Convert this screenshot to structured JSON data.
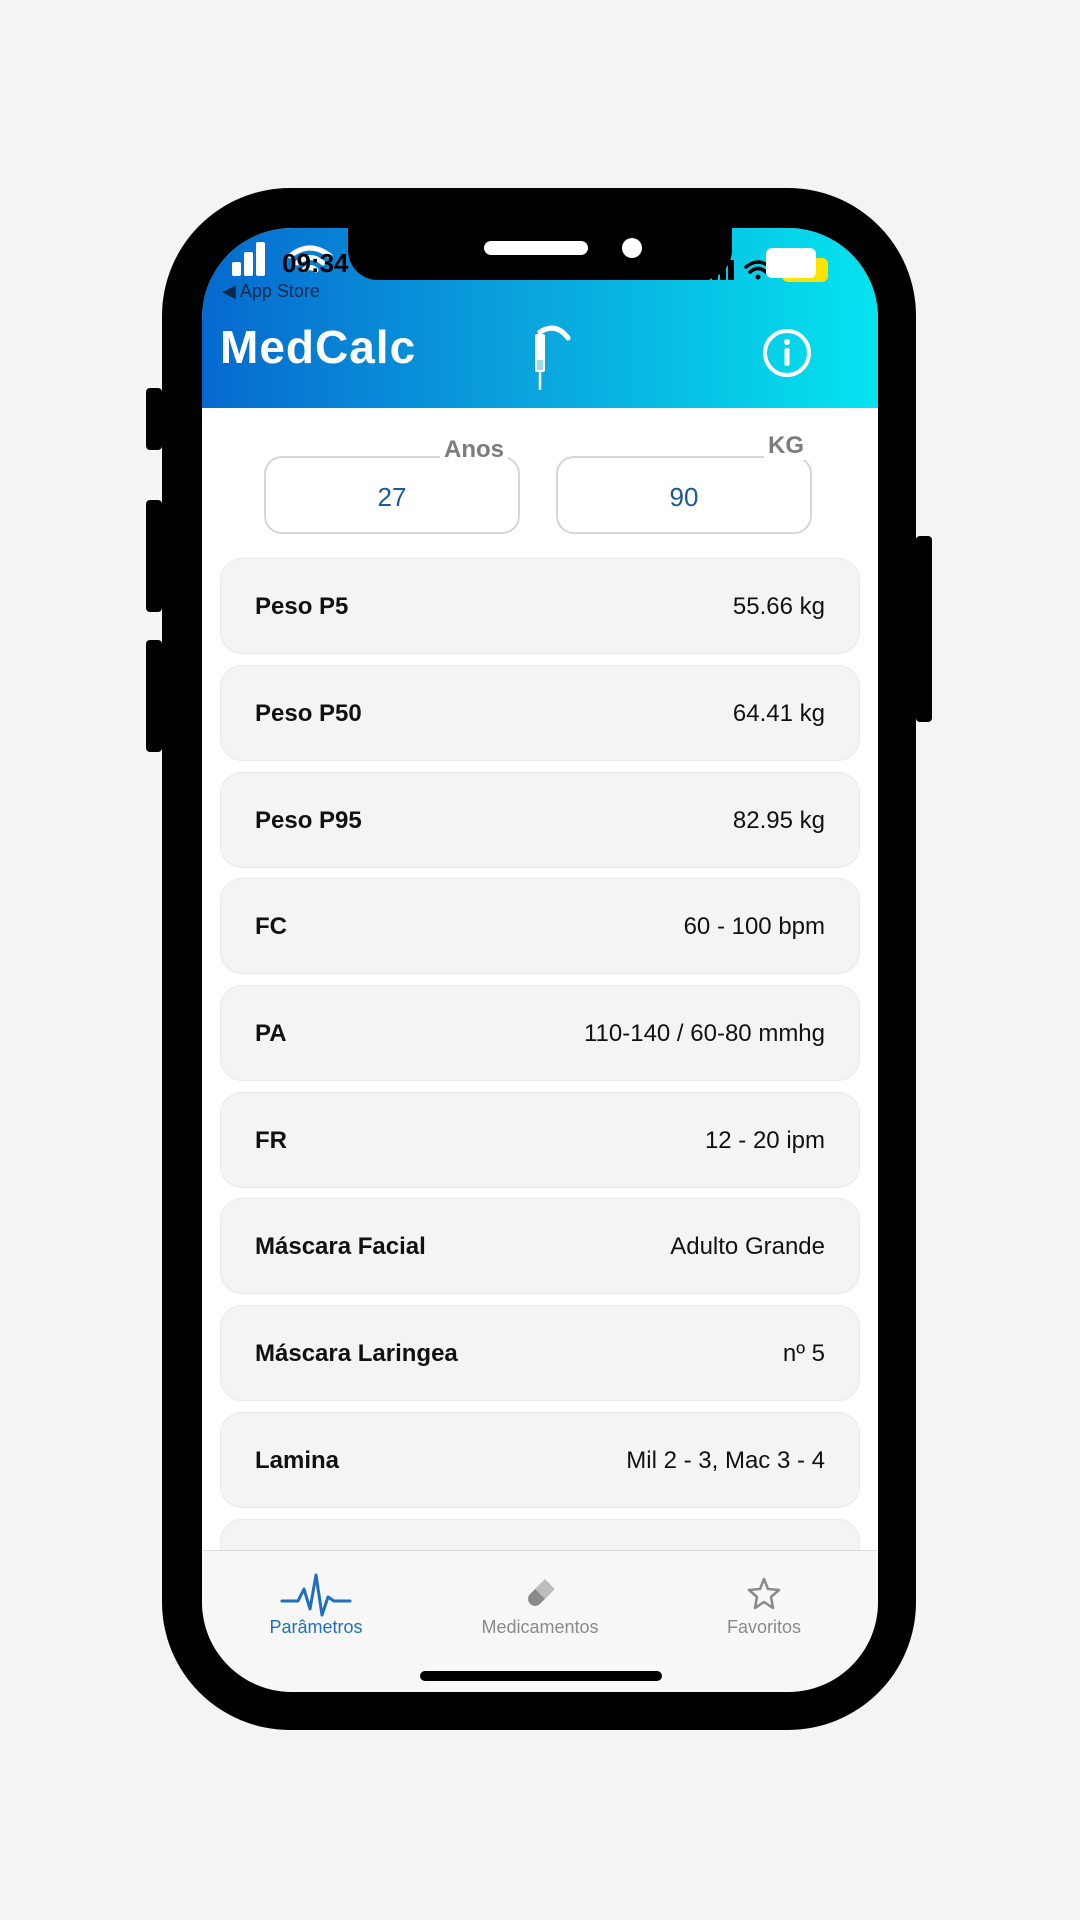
{
  "status_bar": {
    "time": "09:34",
    "back_label": "◀ App Store",
    "battery": "38"
  },
  "header": {
    "title": "MedCalc",
    "logo_icon": "syringe-scythe-icon",
    "info_icon": "info-circle-icon"
  },
  "inputs": {
    "age": {
      "label": "Anos",
      "value": "27"
    },
    "weight": {
      "label": "KG",
      "value": "90"
    }
  },
  "parameters": [
    {
      "name": "Peso P5",
      "value": "55.66 kg"
    },
    {
      "name": "Peso P50",
      "value": "64.41 kg"
    },
    {
      "name": "Peso P95",
      "value": "82.95 kg"
    },
    {
      "name": "FC",
      "value": "60 - 100 bpm"
    },
    {
      "name": "PA",
      "value": "110-140 / 60-80 mmhg"
    },
    {
      "name": "FR",
      "value": "12 - 20 ipm"
    },
    {
      "name": "Máscara Facial",
      "value": "Adulto Grande"
    },
    {
      "name": "Máscara Laringea",
      "value": "nº 5"
    },
    {
      "name": "Lamina",
      "value": "Mil 2 - 3, Mac 3 - 4"
    }
  ],
  "tabs": [
    {
      "label": "Parâmetros",
      "icon": "heartbeat-icon",
      "active": true
    },
    {
      "label": "Medicamentos",
      "icon": "pill-icon",
      "active": false
    },
    {
      "label": "Favoritos",
      "icon": "star-icon",
      "active": false
    }
  ],
  "colors": {
    "header_start": "#0669cf",
    "header_end": "#04e4ee",
    "accent": "#1f6fc0",
    "input_value": "#1a5a9a"
  }
}
